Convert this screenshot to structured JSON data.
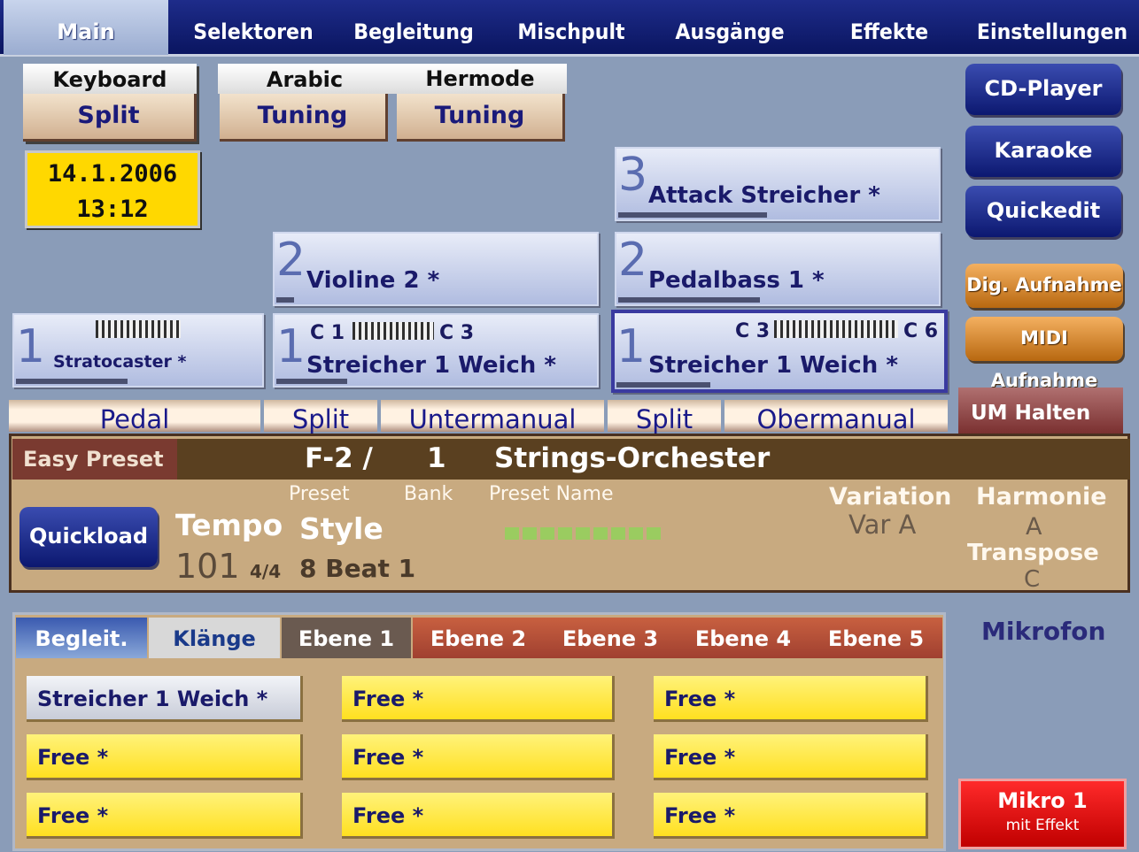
{
  "menu": {
    "items": [
      "Main",
      "Selektoren",
      "Begleitung",
      "Mischpult",
      "Ausgänge",
      "Effekte",
      "Einstellungen"
    ],
    "active": "Main"
  },
  "keyboard_split": {
    "top": "Keyboard",
    "bottom": "Split"
  },
  "arabic_tuning": {
    "top": "Arabic",
    "bottom": "Tuning"
  },
  "hermode_tuning": {
    "top": "Hermode",
    "bottom": "Tuning"
  },
  "datetime": {
    "date": "14.1.2006",
    "time": "13:12"
  },
  "right_buttons": {
    "cd_player": "CD-Player",
    "karaoke": "Karaoke",
    "quickedit": "Quickedit",
    "dig_aufnahme": "Dig. Aufnahme",
    "midi_aufnahme": "MIDI Aufnahme",
    "um_halten": "UM Halten"
  },
  "voices": {
    "upper3": {
      "num": "3",
      "name": "Attack Streicher *"
    },
    "lower2": {
      "num": "2",
      "name": "Violine 2 *"
    },
    "upper2": {
      "num": "2",
      "name": "Pedalbass 1 *"
    },
    "pedal1": {
      "num": "1",
      "name": "Stratocaster *"
    },
    "lower1": {
      "num": "1",
      "name": "Streicher 1 Weich *",
      "range_low": "C 1",
      "range_high": "C 3"
    },
    "upper1": {
      "num": "1",
      "name": "Streicher 1 Weich *",
      "range_low": "C 3",
      "range_high": "C 6"
    }
  },
  "manuals": {
    "pedal": "Pedal",
    "split1": "Split",
    "untermanual": "Untermanual",
    "split2": "Split",
    "obermanual": "Obermanual"
  },
  "preset": {
    "easy_preset": "Easy Preset",
    "preset_value": "F-2 /",
    "bank_value": "1",
    "name_value": "Strings-Orchester",
    "label_preset": "Preset",
    "label_bank": "Bank",
    "label_name": "Preset Name",
    "tempo_label": "Tempo",
    "style_label": "Style",
    "tempo_value": "101",
    "time_signature": "4/4",
    "style_value": "8 Beat 1",
    "variation_label": "Variation",
    "variation_value": "Var A",
    "harmonie_label": "Harmonie",
    "harmonie_value": "A",
    "transpose_label": "Transpose",
    "transpose_value": "C",
    "quickload": "Quickload"
  },
  "tabs": {
    "begleit": "Begleit.",
    "klange": "Klänge",
    "ebene1": "Ebene 1",
    "ebene2": "Ebene 2",
    "ebene3": "Ebene 3",
    "ebene4": "Ebene 4",
    "ebene5": "Ebene 5"
  },
  "slots": [
    "Streicher 1 Weich *",
    "Free *",
    "Free *",
    "Free *",
    "Free *",
    "Free *",
    "Free *",
    "Free *",
    "Free *"
  ],
  "mikrofon": "Mikrofon",
  "mikro1": {
    "title": "Mikro 1",
    "sub": "mit Effekt"
  },
  "colors": {
    "background": "#8a9cb8",
    "menu": "#0a1560",
    "slot_yellow": "#ffe020",
    "mikro_red": "#e00000",
    "orange_button": "#d88a30"
  }
}
